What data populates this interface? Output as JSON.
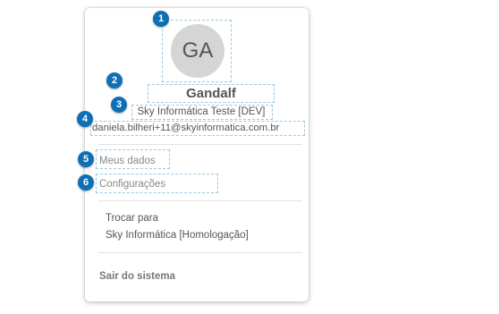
{
  "profile": {
    "initials": "GA",
    "name": "Gandalf",
    "company": "Sky Informática Teste [DEV]",
    "email": "daniela.bilheri+11@skyinformatica.com.br"
  },
  "menu": {
    "my_data": "Meus dados",
    "settings": "Configurações"
  },
  "switch": {
    "label": "Trocar para",
    "target": "Sky Informática [Homologação]"
  },
  "logout": "Sair do sistema",
  "callouts": [
    "1",
    "2",
    "3",
    "4",
    "5",
    "6"
  ],
  "colors": {
    "callout": "#0f6fb5",
    "avatar_bg": "#d5d5d5",
    "highlight_border": "#9ec8e0"
  }
}
